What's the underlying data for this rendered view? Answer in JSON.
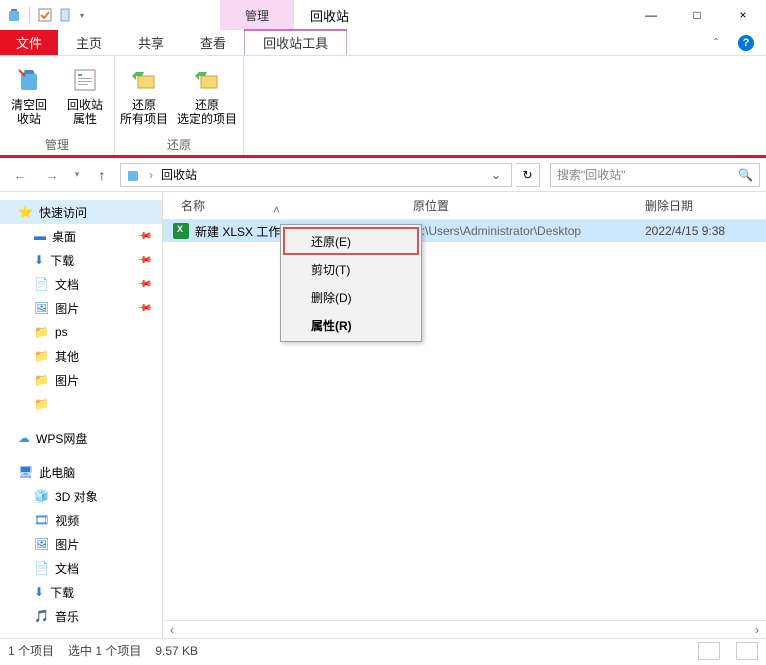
{
  "title": {
    "context_tab": "管理",
    "app": "回收站"
  },
  "winbuttons": {
    "min": "—",
    "max": "□",
    "close": "×"
  },
  "tabs": {
    "file": "文件",
    "home": "主页",
    "share": "共享",
    "view": "查看",
    "tools": "回收站工具"
  },
  "ribbon": {
    "group_manage": {
      "label": "管理",
      "empty": "清空回\n收站",
      "props": "回收站\n属性"
    },
    "group_restore": {
      "label": "还原",
      "restore_all": "还原\n所有项目",
      "restore_sel": "还原\n选定的项目"
    }
  },
  "nav": {
    "location_root": "回收站",
    "search_ph": "搜索\"回收站\""
  },
  "columns": {
    "name": "名称",
    "loc": "原位置",
    "date": "删除日期"
  },
  "items": [
    {
      "name": "新建 XLSX 工作表",
      "loc": "C:\\Users\\Administrator\\Desktop",
      "date": "2022/4/15 9:38"
    }
  ],
  "context_menu": {
    "restore": "还原(E)",
    "cut": "剪切(T)",
    "delete": "删除(D)",
    "props": "属性(R)"
  },
  "sidebar": {
    "quick": "快速访问",
    "desktop": "桌面",
    "downloads": "下载",
    "documents": "文档",
    "pictures": "图片",
    "ps": "ps",
    "other": "其他",
    "pictures2": "图片",
    "wps": "WPS网盘",
    "thispc": "此电脑",
    "obj3d": "3D 对象",
    "video": "视频",
    "pictures3": "图片",
    "documents2": "文档",
    "downloads2": "下载",
    "music": "音乐"
  },
  "status": {
    "count": "1 个项目",
    "selected": "选中 1 个项目",
    "size": "9.57 KB"
  }
}
